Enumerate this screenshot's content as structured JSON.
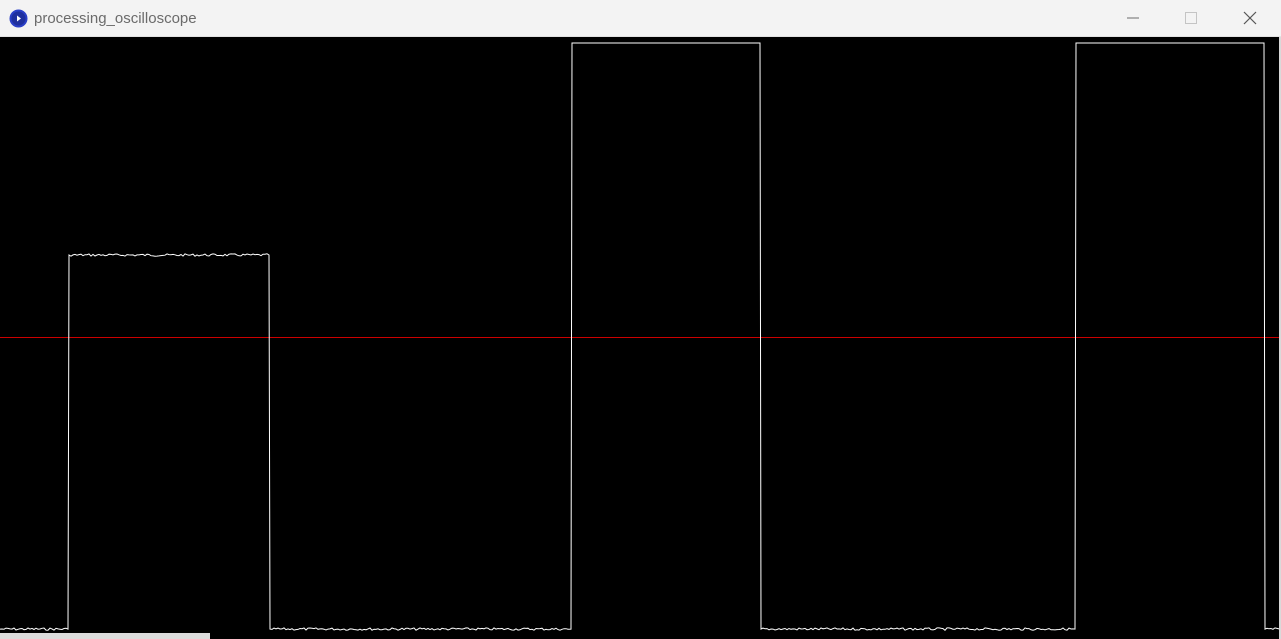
{
  "window": {
    "title": "processing_oscilloscope",
    "icon": "processing-app-icon",
    "controls": {
      "minimize_icon": "minimize-icon",
      "maximize_icon": "maximize-icon",
      "close_icon": "close-icon"
    }
  },
  "colors": {
    "titlebar_bg": "#f3f3f3",
    "title_text": "#6b6b6b",
    "canvas_bg": "#000000",
    "trace": "#ffffff",
    "reference_line": "#cc0000",
    "app_icon": "#2a3fc7"
  },
  "chart_data": {
    "type": "line",
    "title": "",
    "xlabel": "",
    "ylabel": "",
    "grid": false,
    "xlim": [
      0,
      1280
    ],
    "ylim": [
      0,
      1
    ],
    "reference_level": 0.5,
    "series": [
      {
        "x": [
          0,
          68,
          69,
          269,
          270,
          571,
          572,
          760,
          761,
          1075,
          1076,
          1264,
          1265,
          1280
        ],
        "y": [
          0.005,
          0.005,
          0.64,
          0.64,
          0.005,
          0.005,
          1.0,
          1.0,
          0.005,
          0.005,
          1.0,
          1.0,
          0.005,
          0.005
        ]
      }
    ]
  }
}
